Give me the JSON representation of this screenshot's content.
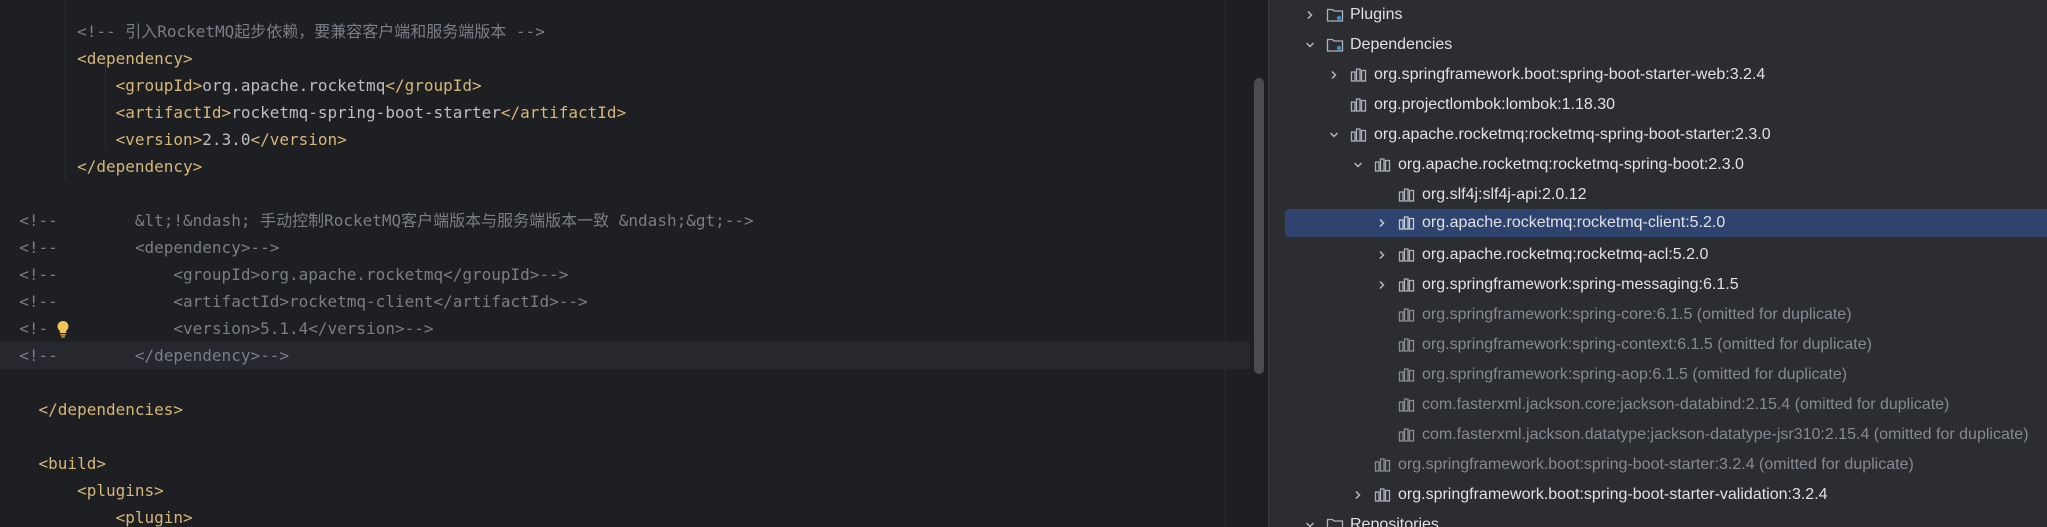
{
  "editor": {
    "lines": [
      {
        "tokens": [
          {
            "t": "cmt",
            "v": "<!-- 引入RocketMQ起步依赖，要兼容客户端和服务端版本 -->"
          }
        ]
      },
      {
        "tokens": [
          {
            "t": "tag",
            "v": "<dependency>"
          }
        ]
      },
      {
        "tokens": [
          {
            "t": "tag",
            "v": "<groupId>"
          },
          {
            "t": "text",
            "v": "org.apache.rocketmq"
          },
          {
            "t": "tag",
            "v": "</groupId>"
          }
        ]
      },
      {
        "tokens": [
          {
            "t": "tag",
            "v": "<artifactId>"
          },
          {
            "t": "text",
            "v": "rocketmq-spring-boot-starter"
          },
          {
            "t": "tag",
            "v": "</artifactId>"
          }
        ]
      },
      {
        "tokens": [
          {
            "t": "tag",
            "v": "<version>"
          },
          {
            "t": "text",
            "v": "2.3.0"
          },
          {
            "t": "tag",
            "v": "</version>"
          }
        ]
      },
      {
        "tokens": [
          {
            "t": "tag",
            "v": "</dependency>"
          }
        ]
      },
      {
        "tokens": []
      },
      {
        "tokens": [
          {
            "t": "cmt",
            "v": "<!--"
          },
          {
            "t": "cmt",
            "v": "&lt;!&ndash; 手动控制RocketMQ客户端版本与服务端版本一致 &ndash;&gt;-->"
          }
        ]
      },
      {
        "tokens": [
          {
            "t": "cmt",
            "v": "<!--"
          },
          {
            "t": "cmt",
            "v": "<dependency>-->"
          }
        ]
      },
      {
        "tokens": [
          {
            "t": "cmt",
            "v": "<!--"
          },
          {
            "t": "cmt",
            "v": "<groupId>org.apache.rocketmq</groupId>-->"
          }
        ]
      },
      {
        "tokens": [
          {
            "t": "cmt",
            "v": "<!--"
          },
          {
            "t": "cmt",
            "v": "<artifactId>rocketmq-client</artifactId>-->"
          }
        ]
      },
      {
        "tokens": [
          {
            "t": "cmt",
            "v": "<!-"
          },
          {
            "t": "cmt",
            "v": "<version>5.1.4</version>-->"
          }
        ]
      },
      {
        "tokens": [
          {
            "t": "cmt",
            "v": "<!--"
          },
          {
            "t": "cmt",
            "v": "</dependency>-->"
          }
        ]
      },
      {
        "tokens": []
      },
      {
        "tokens": [
          {
            "t": "tag",
            "v": "</dependencies>"
          }
        ]
      },
      {
        "tokens": []
      },
      {
        "tokens": [
          {
            "t": "tag",
            "v": "<build>"
          }
        ]
      },
      {
        "tokens": [
          {
            "t": "tag",
            "v": "<plugins>"
          }
        ]
      },
      {
        "tokens": [
          {
            "t": "tag",
            "v": "<plugin>"
          }
        ]
      }
    ]
  },
  "tree": {
    "rows": [
      {
        "label": "Plugins",
        "icon": "folder-icon",
        "expanded": false,
        "expandable": true,
        "omitted": false,
        "selected": false
      },
      {
        "label": "Dependencies",
        "icon": "folder-icon",
        "expanded": true,
        "expandable": true,
        "omitted": false,
        "selected": false
      },
      {
        "label": "org.springframework.boot:spring-boot-starter-web:3.2.4",
        "icon": "library-icon",
        "expanded": false,
        "expandable": true,
        "omitted": false,
        "selected": false
      },
      {
        "label": "org.projectlombok:lombok:1.18.30",
        "icon": "library-icon",
        "expanded": false,
        "expandable": false,
        "omitted": false,
        "selected": false
      },
      {
        "label": "org.apache.rocketmq:rocketmq-spring-boot-starter:2.3.0",
        "icon": "library-icon",
        "expanded": true,
        "expandable": true,
        "omitted": false,
        "selected": false
      },
      {
        "label": "org.apache.rocketmq:rocketmq-spring-boot:2.3.0",
        "icon": "library-icon",
        "expanded": true,
        "expandable": true,
        "omitted": false,
        "selected": false
      },
      {
        "label": "org.slf4j:slf4j-api:2.0.12",
        "icon": "library-icon",
        "expanded": false,
        "expandable": false,
        "omitted": false,
        "selected": false
      },
      {
        "label": "org.apache.rocketmq:rocketmq-client:5.2.0",
        "icon": "library-icon",
        "expanded": false,
        "expandable": true,
        "omitted": false,
        "selected": true
      },
      {
        "label": "org.apache.rocketmq:rocketmq-acl:5.2.0",
        "icon": "library-icon",
        "expanded": false,
        "expandable": true,
        "omitted": false,
        "selected": false
      },
      {
        "label": "org.springframework:spring-messaging:6.1.5",
        "icon": "library-icon",
        "expanded": false,
        "expandable": true,
        "omitted": false,
        "selected": false
      },
      {
        "label": "org.springframework:spring-core:6.1.5 (omitted for duplicate)",
        "icon": "library-icon",
        "expanded": false,
        "expandable": false,
        "omitted": true,
        "selected": false
      },
      {
        "label": "org.springframework:spring-context:6.1.5 (omitted for duplicate)",
        "icon": "library-icon",
        "expanded": false,
        "expandable": false,
        "omitted": true,
        "selected": false
      },
      {
        "label": "org.springframework:spring-aop:6.1.5 (omitted for duplicate)",
        "icon": "library-icon",
        "expanded": false,
        "expandable": false,
        "omitted": true,
        "selected": false
      },
      {
        "label": "com.fasterxml.jackson.core:jackson-databind:2.15.4 (omitted for duplicate)",
        "icon": "library-icon",
        "expanded": false,
        "expandable": false,
        "omitted": true,
        "selected": false
      },
      {
        "label": "com.fasterxml.jackson.datatype:jackson-datatype-jsr310:2.15.4 (omitted for duplicate)",
        "icon": "library-icon",
        "expanded": false,
        "expandable": false,
        "omitted": true,
        "selected": false
      },
      {
        "label": "org.springframework.boot:spring-boot-starter:3.2.4 (omitted for duplicate)",
        "icon": "library-icon",
        "expanded": false,
        "expandable": false,
        "omitted": true,
        "selected": false
      },
      {
        "label": "org.springframework.boot:spring-boot-starter-validation:3.2.4",
        "icon": "library-icon",
        "expanded": false,
        "expandable": true,
        "omitted": false,
        "selected": false
      },
      {
        "label": "Repositories",
        "icon": "folder-icon",
        "expanded": true,
        "expandable": true,
        "omitted": false,
        "selected": false
      }
    ]
  }
}
